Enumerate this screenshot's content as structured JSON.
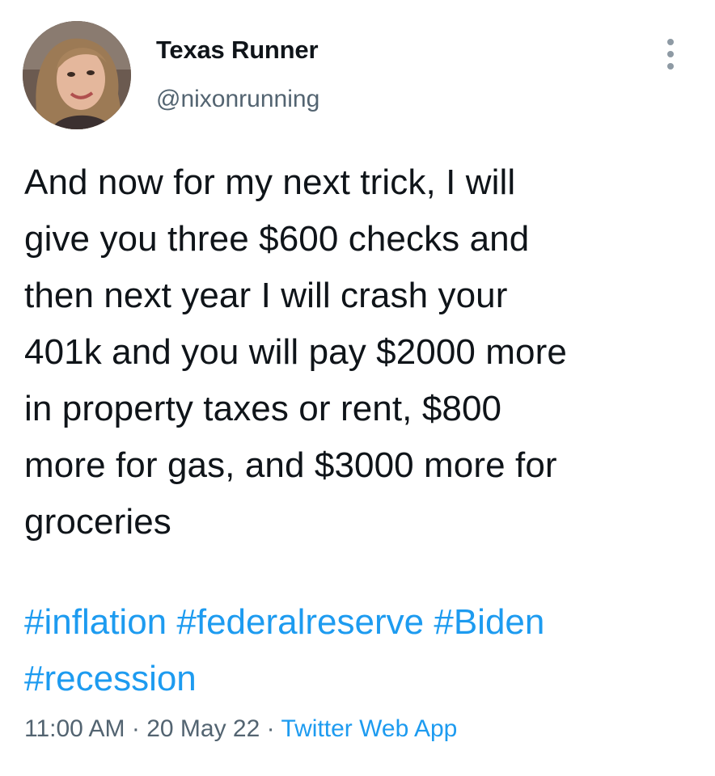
{
  "author": {
    "display_name": "Texas Runner",
    "handle": "@nixonrunning",
    "avatar_icon": "profile-photo"
  },
  "more_options_icon": "vertical-ellipsis-icon",
  "tweet": {
    "text": "And now for my next trick, I will\ngive you three $600 checks and\nthen next year I will crash your\n401k and you will pay $2000 more\nin property taxes or rent, $800\nmore for gas, and $3000 more for\ngroceries",
    "hashtags": [
      "#inflation",
      "#federalreserve",
      "#Biden",
      "#recession"
    ],
    "time": "11:00 AM",
    "separator": "·",
    "date": "20 May 22",
    "source": "Twitter Web App"
  },
  "colors": {
    "link": "#1d9bf0",
    "secondary_text": "#536471",
    "primary_text": "#0f1419"
  }
}
